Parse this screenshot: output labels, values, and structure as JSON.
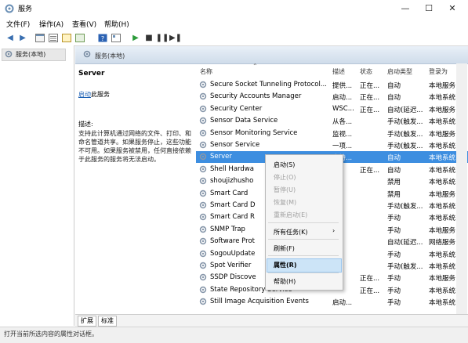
{
  "window": {
    "title": "服务",
    "controls": {
      "minimize": "—",
      "maximize": "☐",
      "close": "✕"
    }
  },
  "menu": [
    "文件(F)",
    "操作(A)",
    "查看(V)",
    "帮助(H)"
  ],
  "toolbar": {
    "icons": [
      "back-icon",
      "forward-icon",
      "console-icon",
      "list-icon",
      "refresh-icon",
      "export-icon",
      "help-icon",
      "properties-icon",
      "play-icon",
      "stop-icon",
      "pause-icon",
      "restart-icon"
    ]
  },
  "tree": {
    "selected": "服务(本地)"
  },
  "panel": {
    "header": "服务(本地)"
  },
  "detail": {
    "name": "Server",
    "action_link": "启动",
    "action_suffix": "此服务",
    "desc_label": "描述:",
    "desc": "支持此计算机通过网络的文件、打印、和命名管道共享。如果服务停止，这些功能不可用。如果服务被禁用，任何直接依赖于此服务的服务将无法启动。"
  },
  "columns": [
    "名称",
    "描述",
    "状态",
    "启动类型",
    "登录为"
  ],
  "rows": [
    [
      "Secure Socket Tunneling Protocol...",
      "提供...",
      "正在...",
      "自动",
      "本地服务"
    ],
    [
      "Security Accounts Manager",
      "启动...",
      "正在...",
      "自动",
      "本地系统"
    ],
    [
      "Security Center",
      "WSC...",
      "正在...",
      "自动(延迟...",
      "本地服务"
    ],
    [
      "Sensor Data Service",
      "从各...",
      "",
      "手动(触发...",
      "本地系统"
    ],
    [
      "Sensor Monitoring Service",
      "监视...",
      "",
      "手动(触发...",
      "本地服务"
    ],
    [
      "Sensor Service",
      "一项...",
      "",
      "手动(触发...",
      "本地系统"
    ],
    [
      "Server",
      "支持...",
      "",
      "自动",
      "本地系统"
    ],
    [
      "Shell Hardwa",
      "",
      "正在...",
      "自动",
      "本地系统"
    ],
    [
      "shoujizhusho",
      "",
      "",
      "禁用",
      "本地系统"
    ],
    [
      "Smart Card",
      "",
      "",
      "禁用",
      "本地服务"
    ],
    [
      "Smart Card D",
      "",
      "",
      "手动(触发...",
      "本地系统"
    ],
    [
      "Smart Card R",
      "",
      "",
      "手动",
      "本地系统"
    ],
    [
      "SNMP Trap",
      "",
      "",
      "手动",
      "本地服务"
    ],
    [
      "Software Prot",
      "",
      "",
      "自动(延迟...",
      "网络服务"
    ],
    [
      "SogouUpdate",
      "",
      "",
      "手动",
      "本地系统"
    ],
    [
      "Spot Verifier",
      "",
      "",
      "手动(触发...",
      "本地系统"
    ],
    [
      "SSDP Discove",
      "",
      "正在...",
      "手动",
      "本地服务"
    ],
    [
      "State Repository Service",
      "",
      "正在...",
      "手动",
      "本地系统"
    ],
    [
      "Still Image Acquisition Events",
      "启动...",
      "",
      "手动",
      "本地系统"
    ]
  ],
  "context_menu": {
    "items": [
      {
        "label": "启动(S)",
        "enabled": true
      },
      {
        "label": "停止(O)",
        "enabled": false
      },
      {
        "label": "暂停(U)",
        "enabled": false
      },
      {
        "label": "恢复(M)",
        "enabled": false
      },
      {
        "label": "重新启动(E)",
        "enabled": false
      },
      {
        "label": "所有任务(K)",
        "enabled": true,
        "submenu": true
      },
      {
        "label": "刷新(F)",
        "enabled": true
      },
      {
        "label": "属性(R)",
        "enabled": true,
        "highlighted": true
      },
      {
        "label": "帮助(H)",
        "enabled": true
      }
    ],
    "submenu_arrow": "›"
  },
  "tabs": [
    "扩展",
    "标准"
  ],
  "status": "打开当前所选内容的属性对话框。"
}
